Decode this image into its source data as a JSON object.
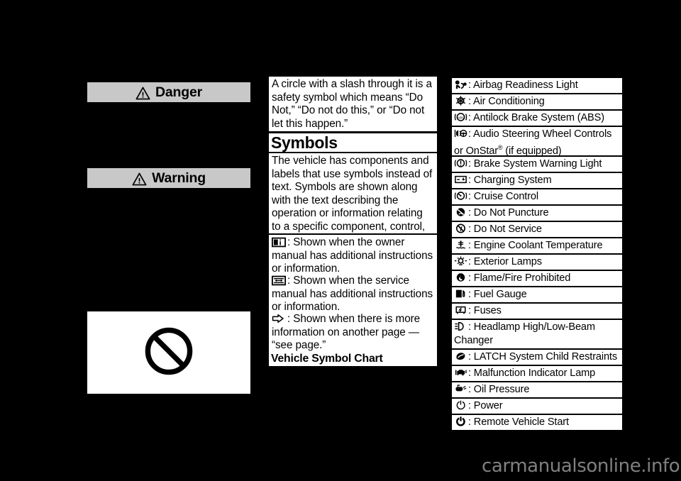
{
  "page": {
    "background": "#000000",
    "alert_fill": "#c8c8c8",
    "text_fill": "#ffffff",
    "watermark": "carmanualsonline.info"
  },
  "left_column": {
    "danger_label": "Danger",
    "warning_label": "Warning",
    "prohibition_image_alt": "no-symbol"
  },
  "middle_column": {
    "circle_slash_paragraph": "A circle with a slash through it is a safety symbol which means “Do Not,” “Do not do this,” or “Do not let this happen.”",
    "symbols_heading": "Symbols",
    "symbols_paragraph": "The vehicle has components and labels that use symbols instead of text. Symbols are shown along with the text describing the operation or information relating to a specific component, control, message, gauge, or indicator.",
    "owner_manual_note": ": Shown when the owner manual has additional instructions or information.",
    "service_manual_note": ": Shown when the service manual has additional instructions or information.",
    "see_page_note": ": Shown when there is more information on another page — “see page.”",
    "chart_heading": "Vehicle Symbol Chart"
  },
  "symbol_chart": {
    "rows": [
      {
        "icon": "airbag-readiness-icon",
        "label": ": Airbag Readiness Light"
      },
      {
        "icon": "air-conditioning-icon",
        "label": ": Air Conditioning"
      },
      {
        "icon": "abs-icon",
        "label": ": Antilock Brake System (ABS)"
      },
      {
        "icon": "audio-steering-wheel-icon",
        "label": ": Audio Steering Wheel Controls or OnStar",
        "sup": "®",
        "label_tail": " (if equipped)"
      },
      {
        "icon": "brake-system-warning-icon",
        "label": ": Brake System Warning Light"
      },
      {
        "icon": "charging-system-icon",
        "label": ": Charging System"
      },
      {
        "icon": "cruise-control-icon",
        "label": ": Cruise Control"
      },
      {
        "icon": "do-not-puncture-icon",
        "label": ": Do Not Puncture"
      },
      {
        "icon": "do-not-service-icon",
        "label": ": Do Not Service"
      },
      {
        "icon": "engine-coolant-temperature-icon",
        "label": ": Engine Coolant Temperature"
      },
      {
        "icon": "exterior-lamps-icon",
        "label": ": Exterior Lamps"
      },
      {
        "icon": "flame-fire-prohibited-icon",
        "label": ": Flame/Fire Prohibited"
      },
      {
        "icon": "fuel-gauge-icon",
        "label": ": Fuel Gauge"
      },
      {
        "icon": "fuses-icon",
        "label": ": Fuses"
      },
      {
        "icon": "headlamp-high-low-beam-icon",
        "label": ": Headlamp High/Low-Beam Changer"
      },
      {
        "icon": "latch-child-restraint-icon",
        "label": ": LATCH System Child Restraints"
      },
      {
        "icon": "malfunction-indicator-icon",
        "label": ": Malfunction Indicator Lamp"
      },
      {
        "icon": "oil-pressure-icon",
        "label": ": Oil Pressure"
      },
      {
        "icon": "power-icon",
        "label": ": Power"
      },
      {
        "icon": "remote-vehicle-start-icon",
        "label": ": Remote Vehicle Start"
      }
    ]
  }
}
